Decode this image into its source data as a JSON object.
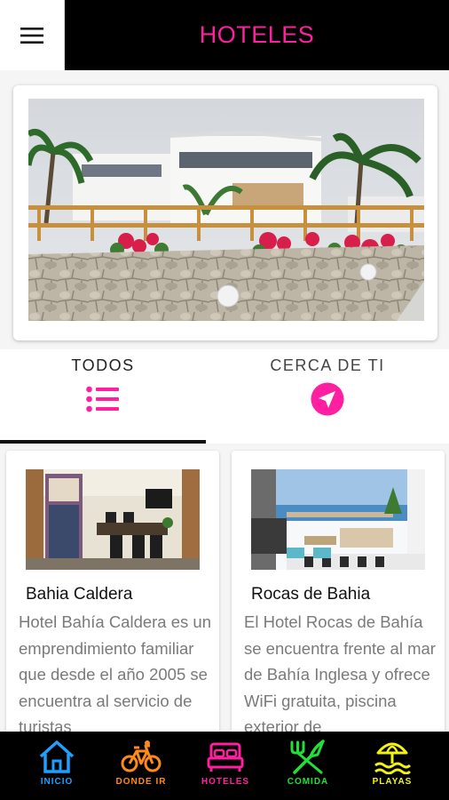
{
  "app_bar": {
    "title": "HOTELES",
    "menu_icon": "hamburger-menu-icon",
    "title_color": "#ff1fa0"
  },
  "hero": {
    "image": "hotel-building-photo"
  },
  "tabs": [
    {
      "label": "TODOS",
      "icon": "list-icon",
      "active": true
    },
    {
      "label": "CERCA DE TI",
      "icon": "location-arrow-icon",
      "active": false
    }
  ],
  "hotels": [
    {
      "name": "Bahia Caldera",
      "image": "hotel-reception-photo",
      "description": "Hotel Bahía Caldera es un emprendimiento familiar que desde el año 2005 se encuentra al servicio de turistas"
    },
    {
      "name": "Rocas de Bahia",
      "image": "hotel-terrace-photo",
      "description": "El Hotel Rocas de Bahía se encuentra frente al mar de Bahía Inglesa y ofrece WiFi gratuita, piscina exterior de"
    }
  ],
  "bottom_nav": [
    {
      "label": "INICIO",
      "icon": "home-icon",
      "color": "#1ea0ff"
    },
    {
      "label": "DONDE IR",
      "icon": "bicycle-icon",
      "color": "#ff8a1a"
    },
    {
      "label": "HOTELES",
      "icon": "bed-icon",
      "color": "#ff1fa0"
    },
    {
      "label": "COMIDA",
      "icon": "fork-knife-icon",
      "color": "#22e03a"
    },
    {
      "label": "PLAYAS",
      "icon": "beach-umbrella-icon",
      "color": "#f2f213"
    }
  ]
}
